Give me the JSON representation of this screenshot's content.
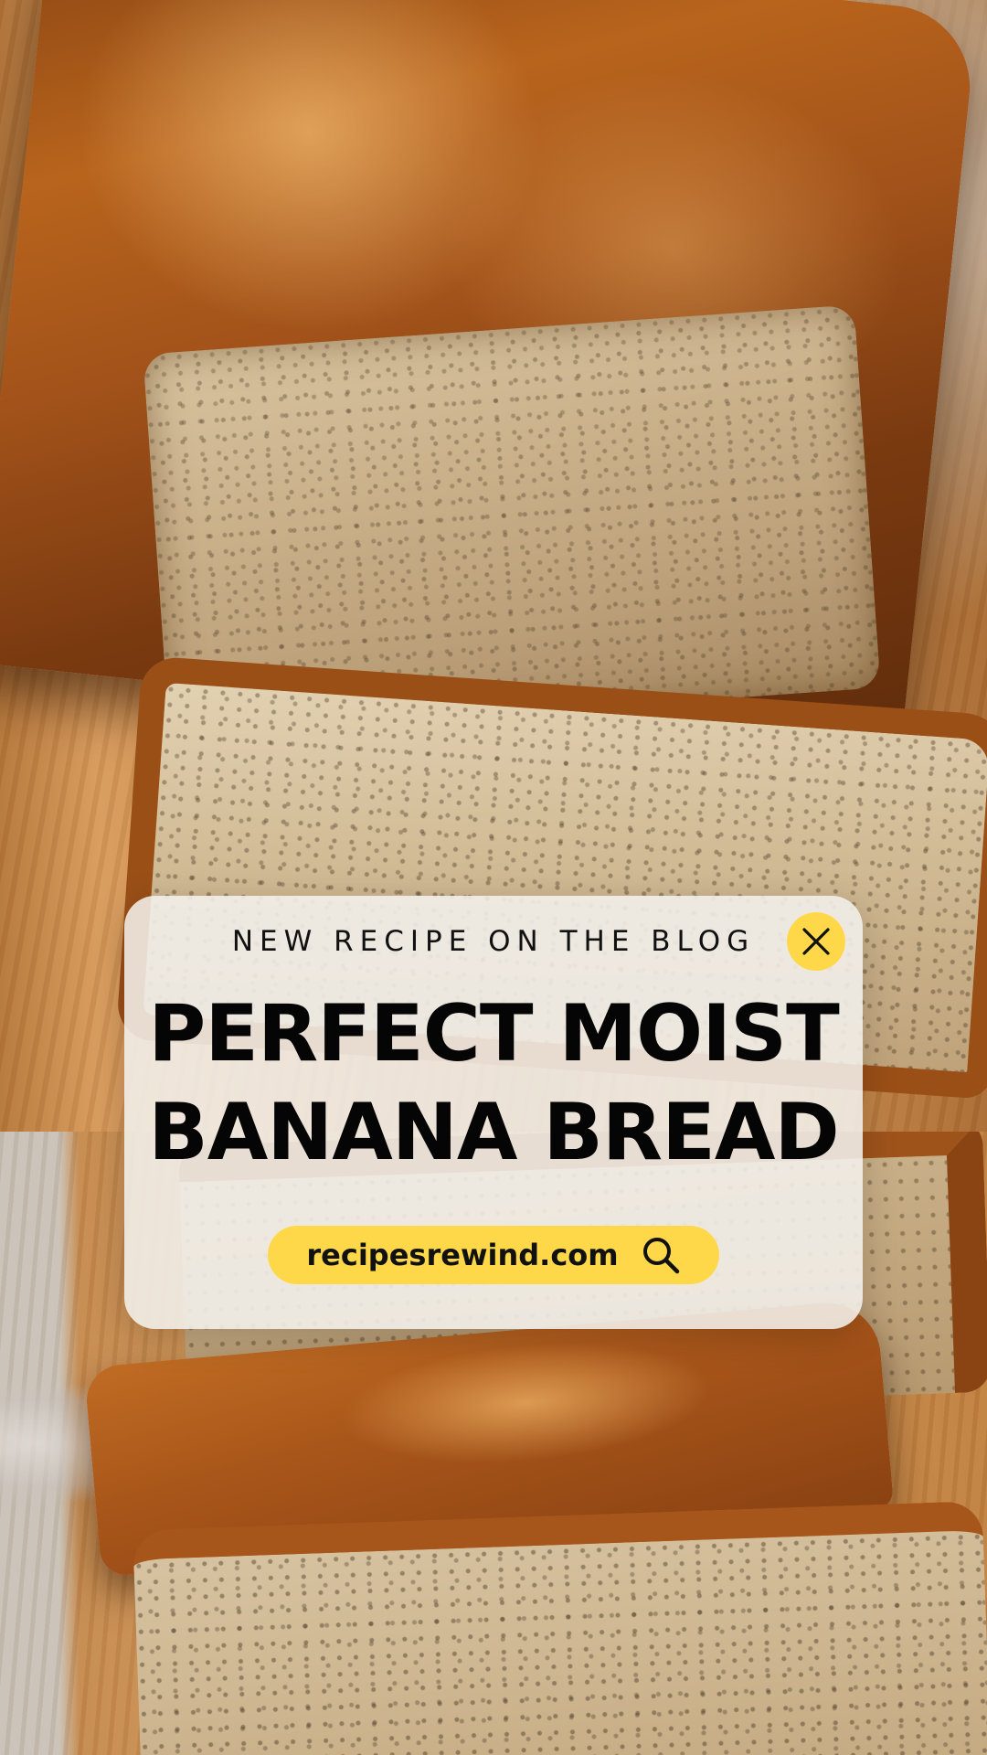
{
  "photo": {
    "subject": "sliced banana bread loaf on wooden cutting board"
  },
  "overlay": {
    "eyebrow": "NEW RECIPE ON THE BLOG",
    "title_line1": "PERFECT MOIST",
    "title_line2": "BANANA BREAD",
    "website": "recipesrewind.com",
    "close_icon": "close-icon",
    "search_icon": "search-icon"
  },
  "colors": {
    "accent_yellow": "#ffd84a",
    "card_background": "#f3f0ec",
    "text": "#050505"
  }
}
